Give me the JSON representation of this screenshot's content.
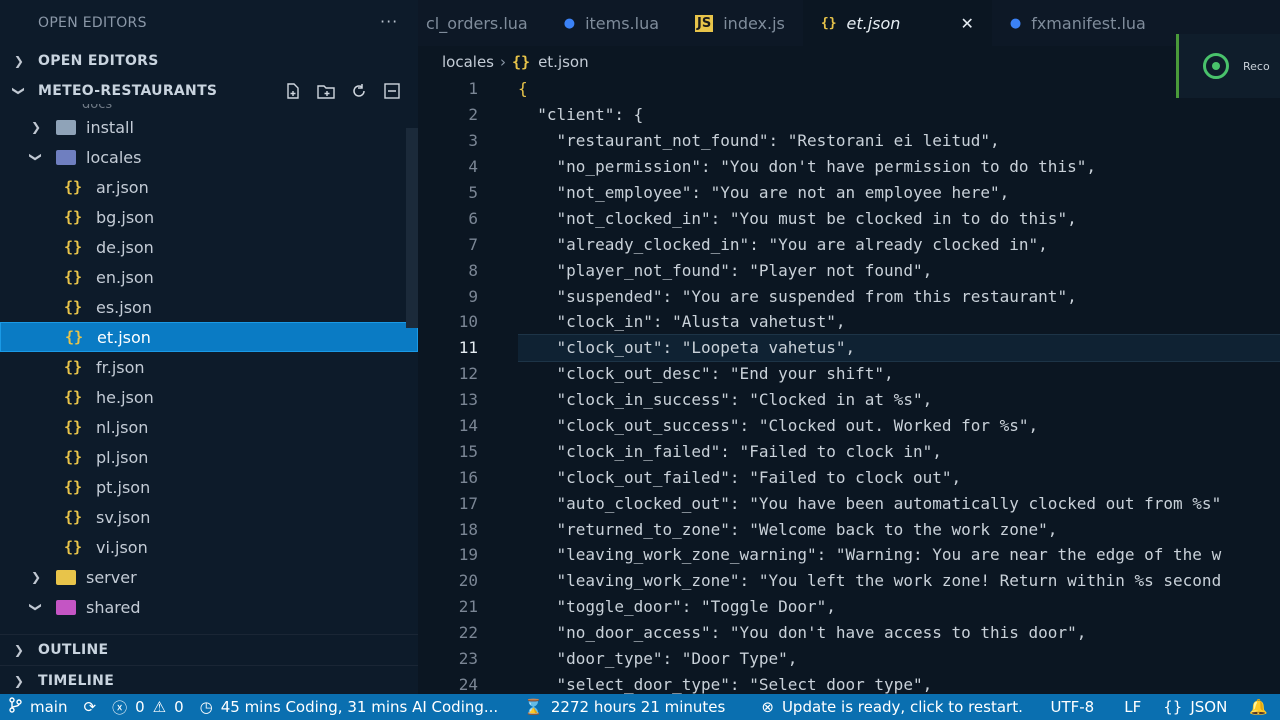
{
  "sidebar": {
    "title": "OPEN EDITORS",
    "open_editors_label": "OPEN EDITORS",
    "project_label": "METEO-RESTAURANTS",
    "partial_folder": "docs",
    "tree": [
      {
        "type": "folder",
        "label": "install",
        "open": false,
        "depth": 1,
        "color": "#8fa3b8"
      },
      {
        "type": "folder",
        "label": "locales",
        "open": true,
        "depth": 1,
        "color": "#6f7fc0"
      },
      {
        "type": "file",
        "label": "ar.json",
        "depth": 2
      },
      {
        "type": "file",
        "label": "bg.json",
        "depth": 2
      },
      {
        "type": "file",
        "label": "de.json",
        "depth": 2
      },
      {
        "type": "file",
        "label": "en.json",
        "depth": 2
      },
      {
        "type": "file",
        "label": "es.json",
        "depth": 2
      },
      {
        "type": "file",
        "label": "et.json",
        "depth": 2,
        "selected": true
      },
      {
        "type": "file",
        "label": "fr.json",
        "depth": 2
      },
      {
        "type": "file",
        "label": "he.json",
        "depth": 2
      },
      {
        "type": "file",
        "label": "nl.json",
        "depth": 2
      },
      {
        "type": "file",
        "label": "pl.json",
        "depth": 2
      },
      {
        "type": "file",
        "label": "pt.json",
        "depth": 2
      },
      {
        "type": "file",
        "label": "sv.json",
        "depth": 2
      },
      {
        "type": "file",
        "label": "vi.json",
        "depth": 2
      },
      {
        "type": "folder",
        "label": "server",
        "open": false,
        "depth": 1,
        "color": "#e8c44a"
      },
      {
        "type": "folder",
        "label": "shared",
        "open": true,
        "depth": 1,
        "color": "#c455c4"
      }
    ],
    "outline_label": "OUTLINE",
    "timeline_label": "TIMELINE"
  },
  "tabs": [
    {
      "label": "cl_orders.lua",
      "icon": "lua-icon",
      "active": false
    },
    {
      "label": "items.lua",
      "icon": "lua-icon",
      "active": false
    },
    {
      "label": "index.js",
      "icon": "js-icon",
      "active": false
    },
    {
      "label": "et.json",
      "icon": "json-icon",
      "active": true
    },
    {
      "label": "fxmanifest.lua",
      "icon": "lua-icon",
      "active": false
    }
  ],
  "breadcrumb": {
    "folder": "locales",
    "file": "et.json"
  },
  "recording": {
    "label": "Reco"
  },
  "editor": {
    "current_line": 11,
    "lines": [
      {
        "n": "1",
        "text": "{"
      },
      {
        "n": "2",
        "text": "  \"client\": {"
      },
      {
        "n": "3",
        "text": "    \"restaurant_not_found\": \"Restorani ei leitud\","
      },
      {
        "n": "4",
        "text": "    \"no_permission\": \"You don't have permission to do this\","
      },
      {
        "n": "5",
        "text": "    \"not_employee\": \"You are not an employee here\","
      },
      {
        "n": "6",
        "text": "    \"not_clocked_in\": \"You must be clocked in to do this\","
      },
      {
        "n": "7",
        "text": "    \"already_clocked_in\": \"You are already clocked in\","
      },
      {
        "n": "8",
        "text": "    \"player_not_found\": \"Player not found\","
      },
      {
        "n": "9",
        "text": "    \"suspended\": \"You are suspended from this restaurant\","
      },
      {
        "n": "10",
        "text": "    \"clock_in\": \"Alusta vahetust\","
      },
      {
        "n": "11",
        "text": "    \"clock_out\": \"Loopeta vahetus\","
      },
      {
        "n": "12",
        "text": "    \"clock_out_desc\": \"End your shift\","
      },
      {
        "n": "13",
        "text": "    \"clock_in_success\": \"Clocked in at %s\","
      },
      {
        "n": "14",
        "text": "    \"clock_out_success\": \"Clocked out. Worked for %s\","
      },
      {
        "n": "15",
        "text": "    \"clock_in_failed\": \"Failed to clock in\","
      },
      {
        "n": "16",
        "text": "    \"clock_out_failed\": \"Failed to clock out\","
      },
      {
        "n": "17",
        "text": "    \"auto_clocked_out\": \"You have been automatically clocked out from %s\""
      },
      {
        "n": "18",
        "text": "    \"returned_to_zone\": \"Welcome back to the work zone\","
      },
      {
        "n": "19",
        "text": "    \"leaving_work_zone_warning\": \"Warning: You are near the edge of the w"
      },
      {
        "n": "20",
        "text": "    \"leaving_work_zone\": \"You left the work zone! Return within %s second"
      },
      {
        "n": "21",
        "text": "    \"toggle_door\": \"Toggle Door\","
      },
      {
        "n": "22",
        "text": "    \"no_door_access\": \"You don't have access to this door\","
      },
      {
        "n": "23",
        "text": "    \"door_type\": \"Door Type\","
      },
      {
        "n": "24",
        "text": "    \"select_door_type\": \"Select door type\","
      }
    ]
  },
  "status": {
    "branch": "main",
    "errors": "0",
    "warnings": "0",
    "coding_time": "45 mins Coding, 31 mins AI Coding...",
    "hours": "2272 hours 21 minutes",
    "update": "Update is ready, click to restart.",
    "encoding": "UTF-8",
    "eol": "LF",
    "language": "JSON"
  }
}
